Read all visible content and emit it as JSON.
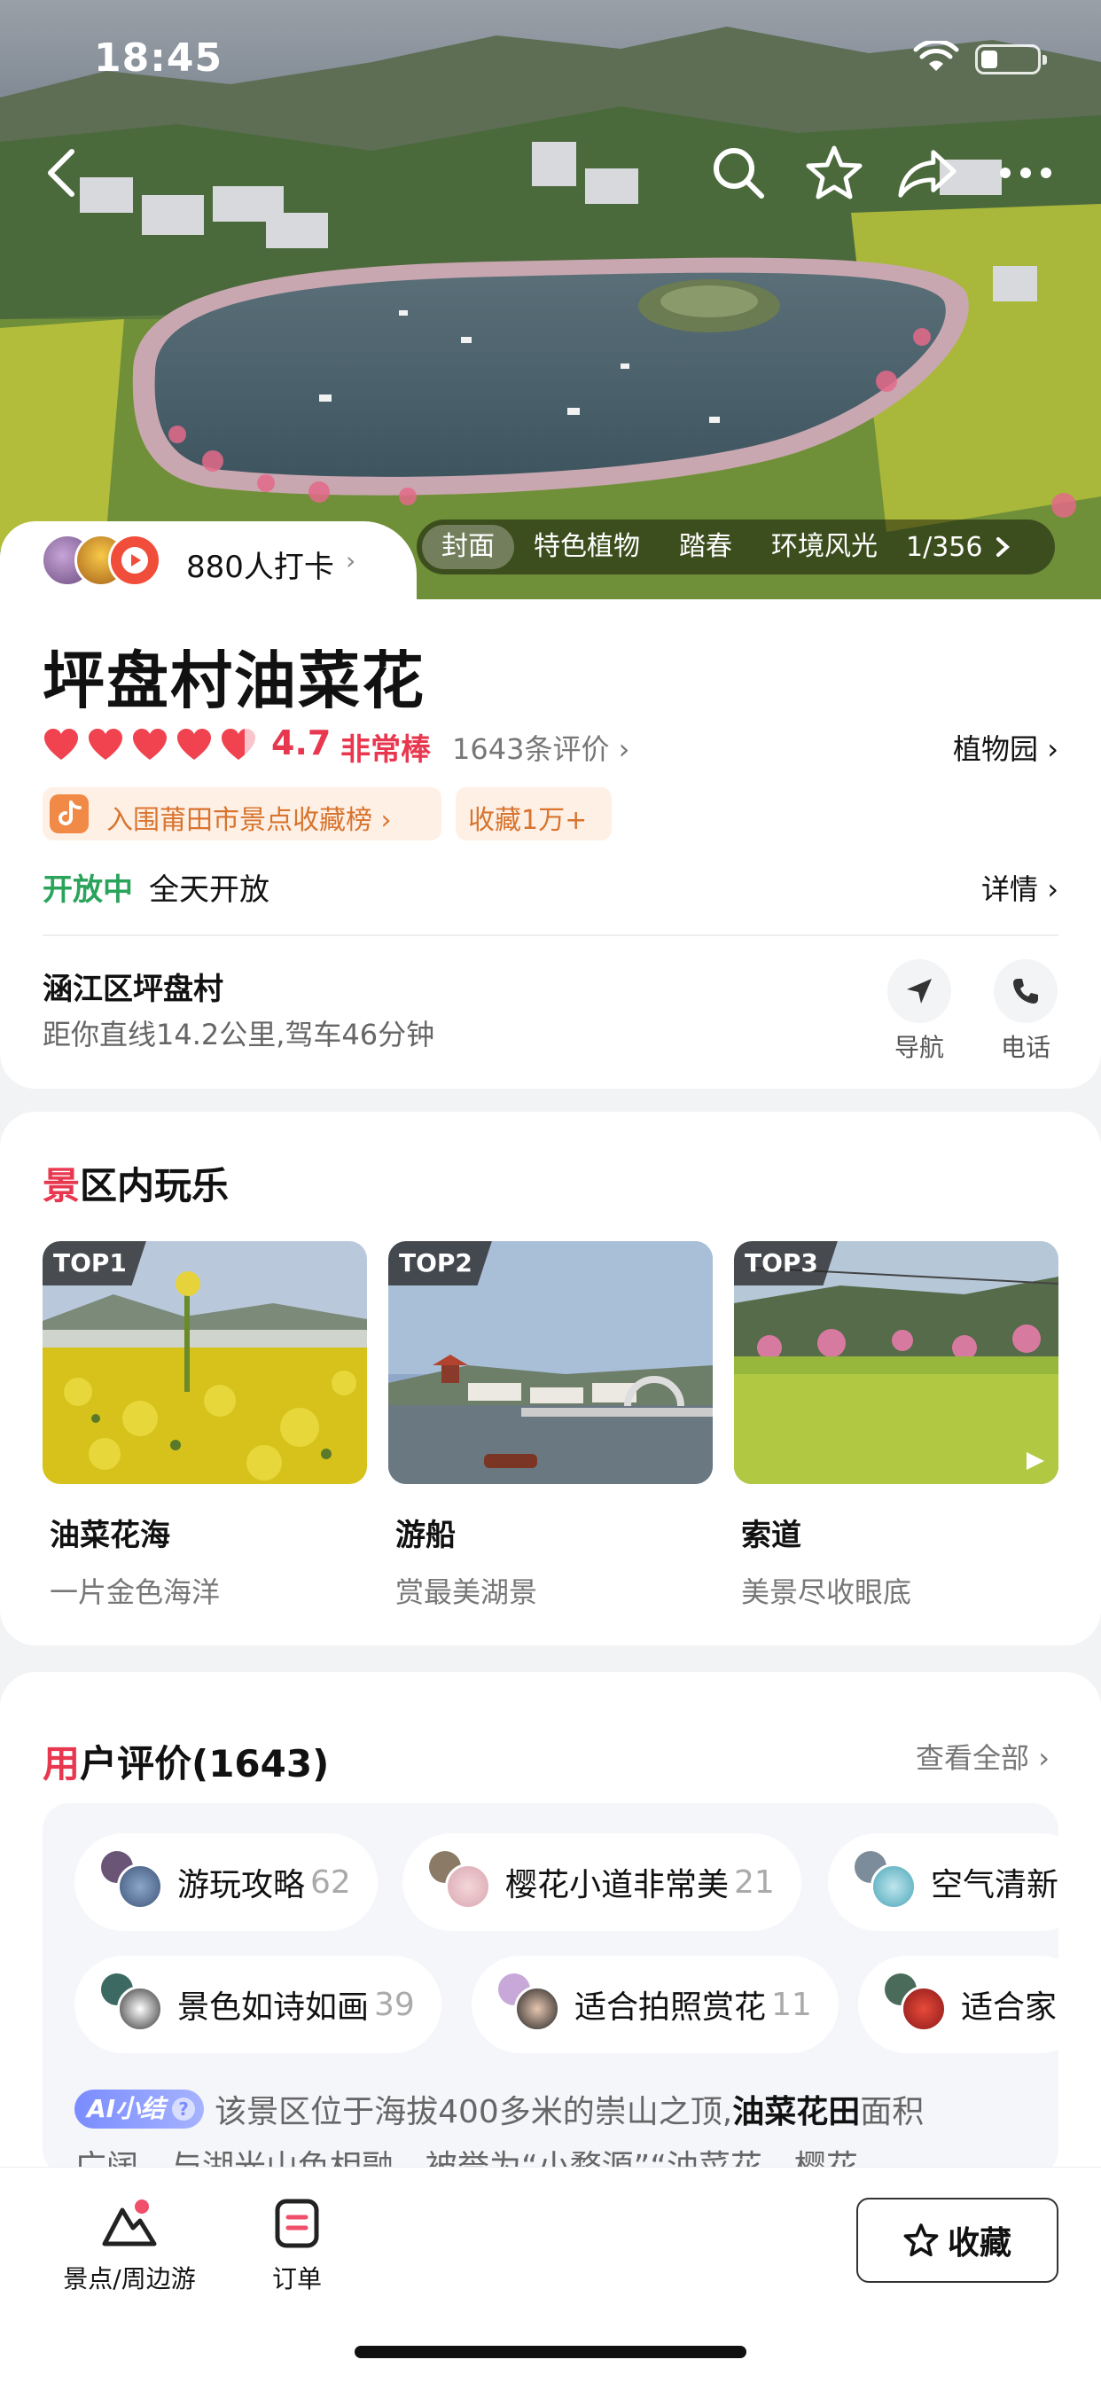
{
  "status_bar": {
    "time": "18:45"
  },
  "hero": {
    "checkin_text": "880人打卡",
    "gallery_tabs": [
      "封面",
      "特色植物",
      "踏春",
      "环境风光"
    ],
    "gallery_count": "1/356"
  },
  "info": {
    "title": "坪盘村油菜花",
    "score": "4.7",
    "score_label": "非常棒",
    "review_count": "1643条评价",
    "category": "植物园",
    "badge_rank": "入围莆田市景点收藏榜",
    "badge_fav": "收藏1万+",
    "open_status": "开放中",
    "open_hours": "全天开放",
    "details_label": "详情",
    "address": "涵江区坪盘村",
    "distance": "距你直线14.2公里,驾车46分钟",
    "nav_label": "导航",
    "phone_label": "电话"
  },
  "activities": {
    "title_accent": "景",
    "title_rest": "区内玩乐",
    "items": [
      {
        "rank": "TOP1",
        "name": "油菜花海",
        "desc": "一片金色海洋"
      },
      {
        "rank": "TOP2",
        "name": "游船",
        "desc": "赏最美湖景"
      },
      {
        "rank": "TOP3",
        "name": "索道",
        "desc": "美景尽收眼底"
      }
    ]
  },
  "reviews": {
    "title_accent": "用",
    "title_rest": "户评价(1643)",
    "view_all": "查看全部",
    "tags": [
      {
        "label": "游玩攻略",
        "count": "62"
      },
      {
        "label": "樱花小道非常美",
        "count": "21"
      },
      {
        "label": "空气清新",
        "count": ""
      },
      {
        "label": "景色如诗如画",
        "count": "39"
      },
      {
        "label": "适合拍照赏花",
        "count": "11"
      },
      {
        "label": "适合家",
        "count": ""
      }
    ],
    "ai_badge": "AI小结",
    "ai_text_1": "该景区位于海拔400多米的崇山之顶,",
    "ai_bold": "油菜花田",
    "ai_text_2": "面积",
    "ai_line2": "广阔，与湖光山色相融，被誉为“小婺源”“油菜花、樱花"
  },
  "bottom_bar": {
    "nav1": "景点/周边游",
    "nav2": "订单",
    "fav_button": "收藏"
  },
  "colors": {
    "accent_red": "#e8384f",
    "open_green": "#2aa35b",
    "badge_orange": "#d8742e"
  }
}
